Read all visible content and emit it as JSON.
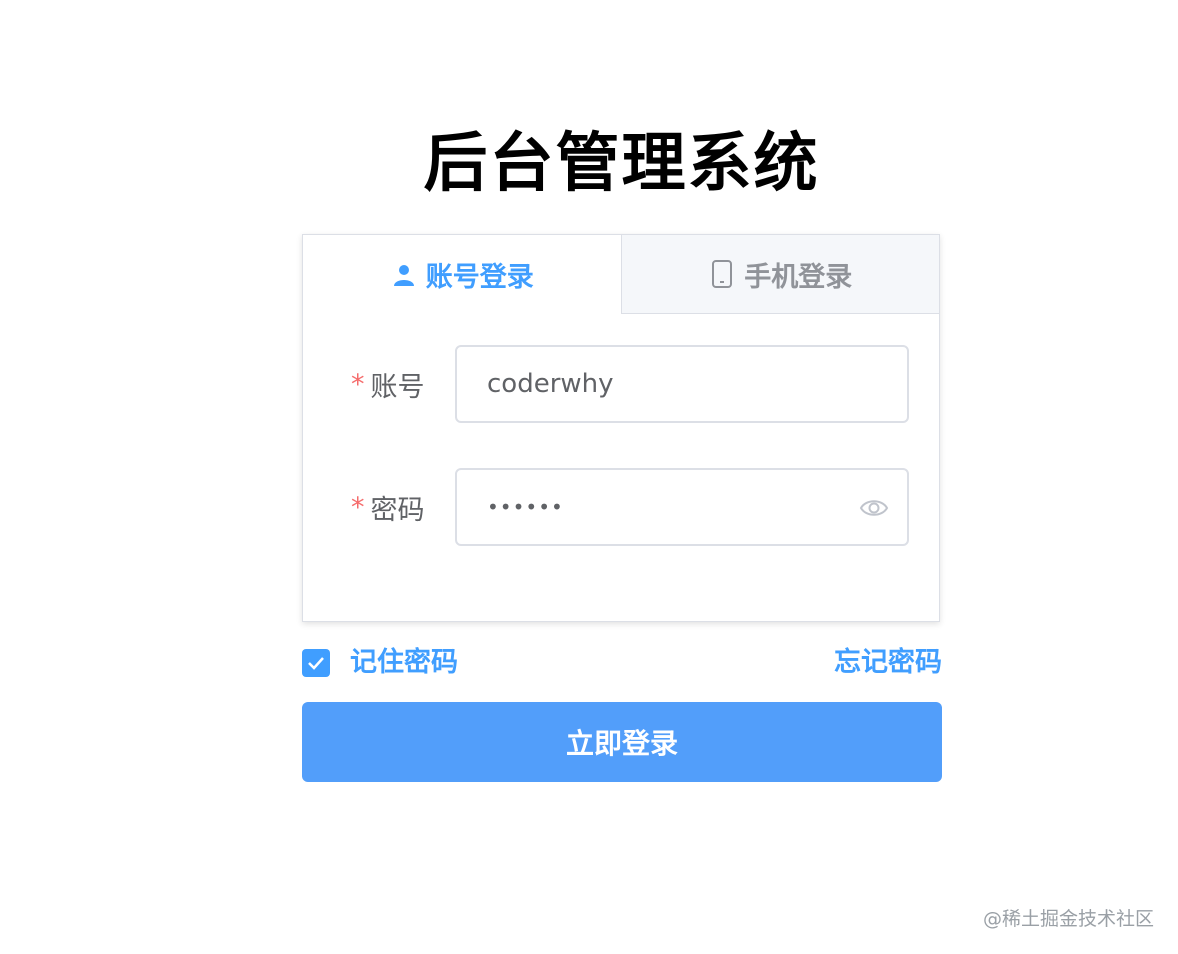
{
  "title": "后台管理系统",
  "tabs": {
    "account": {
      "label": "账号登录",
      "icon": "user-icon"
    },
    "phone": {
      "label": "手机登录",
      "icon": "mobile-phone-icon"
    }
  },
  "form": {
    "account": {
      "required_mark": "*",
      "label": "账号",
      "value": "coderwhy"
    },
    "password": {
      "required_mark": "*",
      "label": "密码",
      "value": "••••••",
      "icon": "eye-icon"
    }
  },
  "remember": {
    "label": "记住密码",
    "checked": true
  },
  "forgot": {
    "label": "忘记密码"
  },
  "login_button": {
    "label": "立即登录"
  },
  "watermark": "@稀土掘金技术社区",
  "colors": {
    "primary": "#409eff",
    "button": "#529efa",
    "required": "#f56c6c",
    "text": "#606266",
    "inactive_tab_bg": "#f5f7fa"
  }
}
